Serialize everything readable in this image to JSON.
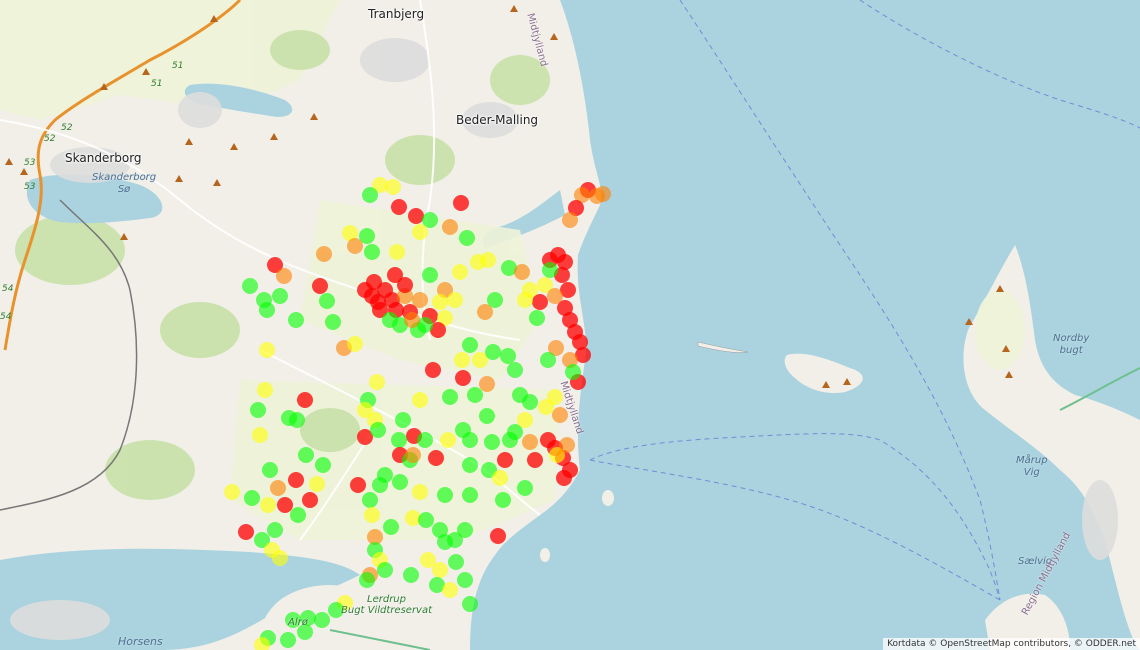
{
  "places": {
    "tranbjerg": "Tranbjerg",
    "beder_malling": "Beder-Malling",
    "skanderborg": "Skanderborg",
    "horsens": "Horsens"
  },
  "water": {
    "skanderborg_so": "Skanderborg\nSø",
    "nordby_bugt": "Nordby\nbugt",
    "marup_vig": "Mårup\nVig",
    "saelvig": "Sælvig"
  },
  "parks": {
    "lerdrup": "Lerdrup\nBugt Vildtreservat",
    "alro": "Alrø"
  },
  "admin": {
    "region_top": "Midtjylland",
    "region_coast": "Midtjylland",
    "region_bottom": "Region Midtjylland"
  },
  "roads": [
    "51",
    "51",
    "52",
    "52",
    "53",
    "53",
    "54",
    "54"
  ],
  "attribution": "Kortdata © OpenStreetMap contributors, © ODDER.net",
  "colors": {
    "sea": "#aad3df",
    "land": "#f2efe9",
    "field": "#eef3d8",
    "forest": "#c8e1a8",
    "dot_red": "#ff0000",
    "dot_orange": "#ff8000",
    "dot_yellow": "#ffff00",
    "dot_green": "#00ff00"
  }
}
